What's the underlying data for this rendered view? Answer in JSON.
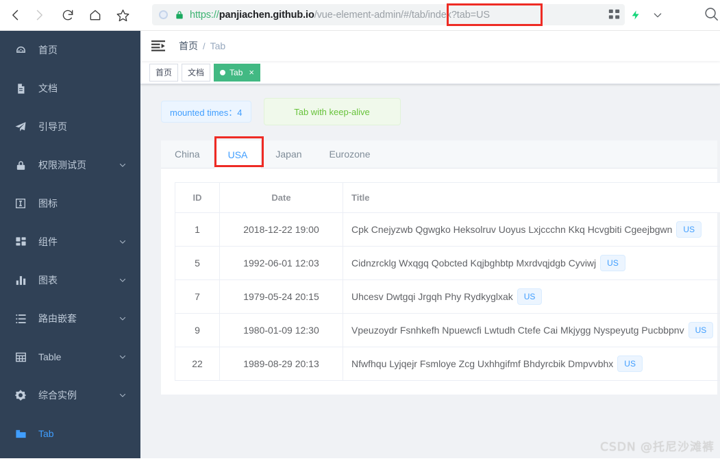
{
  "browser": {
    "nav": {
      "back": "back-arrow",
      "forward": "forward-arrow",
      "reload": "reload",
      "home": "home",
      "bookmark": "star"
    },
    "url": {
      "scheme": "https://",
      "host": "panjiachen.github.io",
      "path": "/vue-element-admin/#/tab/index?tab=US",
      "full": "https://panjiachen.github.io/vue-element-admin/#/tab/index?tab=US"
    },
    "toolbar_icons": [
      "qrcode-icon",
      "lightning-icon",
      "chevron-down-icon",
      "search-icon"
    ]
  },
  "sidebar": {
    "items": [
      {
        "label": "首页",
        "icon": "dashboard-icon",
        "expandable": false,
        "active": false
      },
      {
        "label": "文档",
        "icon": "document-icon",
        "expandable": false,
        "active": false
      },
      {
        "label": "引导页",
        "icon": "guide-paperplane-icon",
        "expandable": false,
        "active": false
      },
      {
        "label": "权限测试页",
        "icon": "lock-icon",
        "expandable": true,
        "active": false
      },
      {
        "label": "图标",
        "icon": "icon-square-icon",
        "expandable": false,
        "active": false
      },
      {
        "label": "组件",
        "icon": "component-grid-icon",
        "expandable": true,
        "active": false
      },
      {
        "label": "图表",
        "icon": "chart-bar-icon",
        "expandable": true,
        "active": false
      },
      {
        "label": "路由嵌套",
        "icon": "nested-list-icon",
        "expandable": true,
        "active": false
      },
      {
        "label": "Table",
        "icon": "table-icon",
        "expandable": true,
        "active": false
      },
      {
        "label": "综合实例",
        "icon": "example-circle-icon",
        "expandable": true,
        "active": false
      },
      {
        "label": "Tab",
        "icon": "tab-icon",
        "expandable": false,
        "active": true
      }
    ]
  },
  "navbar": {
    "hamburger": "hamburger-collapse-icon",
    "breadcrumb": [
      {
        "label": "首页"
      },
      {
        "label": "Tab"
      }
    ],
    "breadcrumb_separator": "/"
  },
  "tags_view": {
    "tags": [
      {
        "label": "首页",
        "active": false,
        "closable": false
      },
      {
        "label": "文档",
        "active": false,
        "closable": false
      },
      {
        "label": "Tab",
        "active": true,
        "closable": true,
        "close_glyph": "×"
      }
    ]
  },
  "content": {
    "mounted_tag": "mounted times：4",
    "keep_alive_tag": "Tab with keep-alive",
    "tabs": [
      {
        "label": "China",
        "active": false
      },
      {
        "label": "USA",
        "active": true
      },
      {
        "label": "Japan",
        "active": false
      },
      {
        "label": "Eurozone",
        "active": false
      }
    ],
    "table": {
      "columns": [
        "ID",
        "Date",
        "Title"
      ],
      "rows": [
        {
          "id": "1",
          "date": "2018-12-22 19:00",
          "title": "Cpk Cnejyzwb Qgwgko Heksolruv Uoyus Lxjccchn Kkq Hcvgbiti Cgeejbgwn",
          "tag": "US"
        },
        {
          "id": "5",
          "date": "1992-06-01 12:03",
          "title": "Cidnzrcklg Wxqgq Qobcted Kqjbghbtp Mxrdvqjdgb Cyviwj",
          "tag": "US"
        },
        {
          "id": "7",
          "date": "1979-05-24 20:15",
          "title": "Uhcesv Dwtgqi Jrgqh Phy Rydkyglxak",
          "tag": "US"
        },
        {
          "id": "9",
          "date": "1980-01-09 12:30",
          "title": "Vpeuzoydr Fsnhkefh Npuewcfi Lwtudh Ctefe Cai Mkjygg Nyspeyutg Pucbbpnv",
          "tag": "US"
        },
        {
          "id": "22",
          "date": "1989-08-29 20:13",
          "title": "Nfwfhqu Lyjqejr Fsmloye Zcg Uxhhgifmf Bhdyrcbik Dmpvvbhx",
          "tag": "US"
        }
      ]
    }
  },
  "watermark": "CSDN @托尼沙滩裤",
  "colors": {
    "sidebar_bg": "#304156",
    "sidebar_text": "#bfcbd9",
    "accent_blue": "#409eff",
    "tag_green": "#42b983",
    "annotation_red": "#ee2b24",
    "page_bg": "#f0f2f5"
  }
}
